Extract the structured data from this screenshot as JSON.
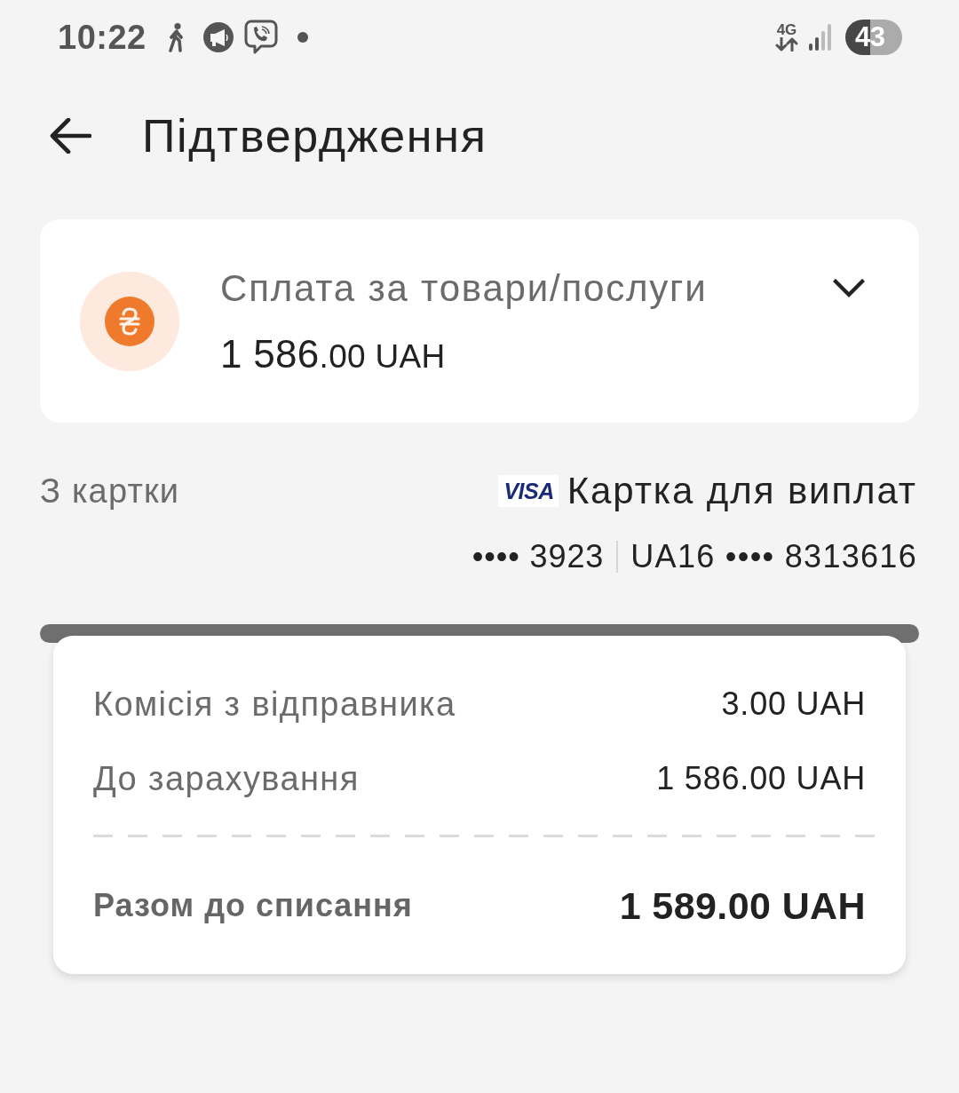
{
  "status_bar": {
    "time": "10:22",
    "network": "4G",
    "battery": "43"
  },
  "header": {
    "title": "Підтвердження"
  },
  "payment": {
    "title": "Сплата за товари/послуги",
    "amount_whole": "1 586",
    "amount_rest": ".00 UAH",
    "expanded": false
  },
  "source": {
    "label": "З картки",
    "card_brand": "VISA",
    "card_name": "Картка для виплат",
    "card_number": "•••• 3923",
    "iban": "UA16 •••• 8313616"
  },
  "summary": {
    "rows": [
      {
        "label": "Комісія з відправника",
        "value": "3.00 UAH"
      },
      {
        "label": "До зарахування",
        "value": "1 586.00 UAH"
      }
    ],
    "total": {
      "label": "Разом до списання",
      "value": "1 589.00 UAH"
    }
  }
}
